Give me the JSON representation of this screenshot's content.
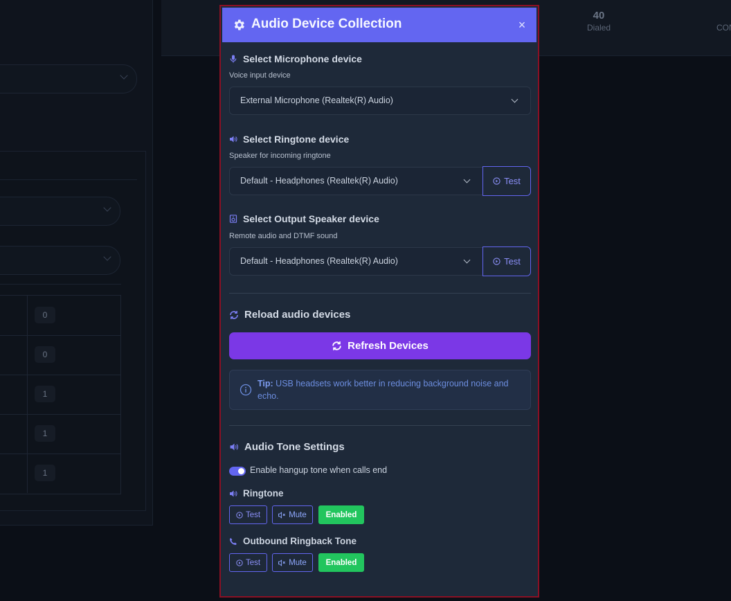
{
  "background": {
    "stats": {
      "value": "40",
      "label": "Dialed",
      "next_label_cut": "CON"
    },
    "table_counts": [
      "0",
      "0",
      "1",
      "1",
      "1"
    ]
  },
  "modal": {
    "title": "Audio Device Collection",
    "close_label": "×",
    "header_icon": "gear-icon",
    "microphone": {
      "title": "Select Microphone device",
      "subtitle": "Voice input device",
      "selected": "External Microphone (Realtek(R) Audio)",
      "icon": "microphone-icon"
    },
    "ringtone": {
      "title": "Select Ringtone device",
      "subtitle": "Speaker for incoming ringtone",
      "selected": "Default - Headphones (Realtek(R) Audio)",
      "test_label": "Test",
      "icon": "volume-icon"
    },
    "speaker": {
      "title": "Select Output Speaker device",
      "subtitle": "Remote audio and DTMF sound",
      "selected": "Default - Headphones (Realtek(R) Audio)",
      "test_label": "Test",
      "icon": "speaker-icon"
    },
    "reload": {
      "title": "Reload audio devices",
      "button_label": "Refresh Devices"
    },
    "tip": {
      "label": "Tip:",
      "text": " USB headsets work better in reducing background noise and echo."
    },
    "tone_settings": {
      "title": "Audio Tone Settings",
      "hangup_toggle_label": "Enable hangup tone when calls end",
      "hangup_enabled": true,
      "ringtone": {
        "title": "Ringtone",
        "test_label": "Test",
        "mute_label": "Mute",
        "status_label": "Enabled"
      },
      "ringback": {
        "title": "Outbound Ringback Tone",
        "test_label": "Test",
        "mute_label": "Mute",
        "status_label": "Enabled"
      }
    }
  },
  "colors": {
    "accent": "#6366f1",
    "refresh": "#7b38e6",
    "enabled": "#22c55e",
    "modal_border": "#8b1024"
  }
}
